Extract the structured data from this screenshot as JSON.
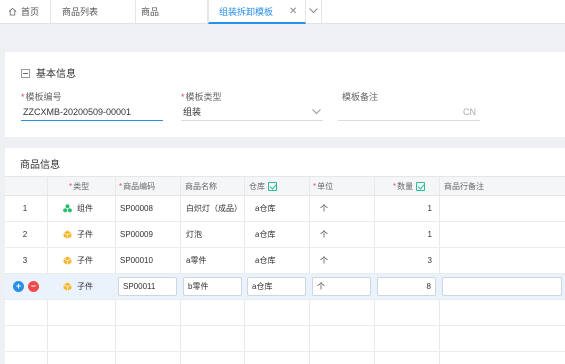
{
  "tabs": {
    "home": "首页",
    "items": [
      "商品列表",
      "商品"
    ],
    "active": "组装拆卸模板",
    "close": "✕"
  },
  "basic": {
    "title": "基本信息",
    "code_label": "模板编号",
    "code_value": "ZZCXMB-20200509-00001",
    "type_label": "模板类型",
    "type_value": "组装",
    "note_label": "模板备注",
    "note_suffix": "CN"
  },
  "goods": {
    "title": "商品信息",
    "columns": [
      "类型",
      "商品编码",
      "商品名称",
      "仓库",
      "单位",
      "数量",
      "商品行备注"
    ],
    "rows": [
      {
        "idx": "1",
        "type": "组件",
        "code": "SP00008",
        "name": "白炽灯（成品）",
        "warehouse": "a仓库",
        "unit": "个",
        "qty": "1",
        "note": ""
      },
      {
        "idx": "2",
        "type": "子件",
        "code": "SP00009",
        "name": "灯泡",
        "warehouse": "a仓库",
        "unit": "个",
        "qty": "1",
        "note": ""
      },
      {
        "idx": "3",
        "type": "子件",
        "code": "SP00010",
        "name": "a零件",
        "warehouse": "a仓库",
        "unit": "个",
        "qty": "3",
        "note": ""
      },
      {
        "idx": "",
        "type": "子件",
        "code": "SP00011",
        "name": "b零件",
        "warehouse": "a仓库",
        "unit": "个",
        "qty": "8",
        "note": ""
      }
    ]
  },
  "colors": {
    "accent": "#2a8fe6",
    "required": "#f04a4a",
    "component_icon": "#2dbd6e",
    "child_icon": "#f5b82e",
    "add": "#2a8fe6",
    "remove": "#f04a4a"
  },
  "icons": [
    "home-icon",
    "close-icon",
    "chevron-down-icon",
    "collapse-icon",
    "checkbox-checked-icon",
    "component-icon",
    "child-part-icon",
    "add-row-icon",
    "remove-row-icon"
  ]
}
